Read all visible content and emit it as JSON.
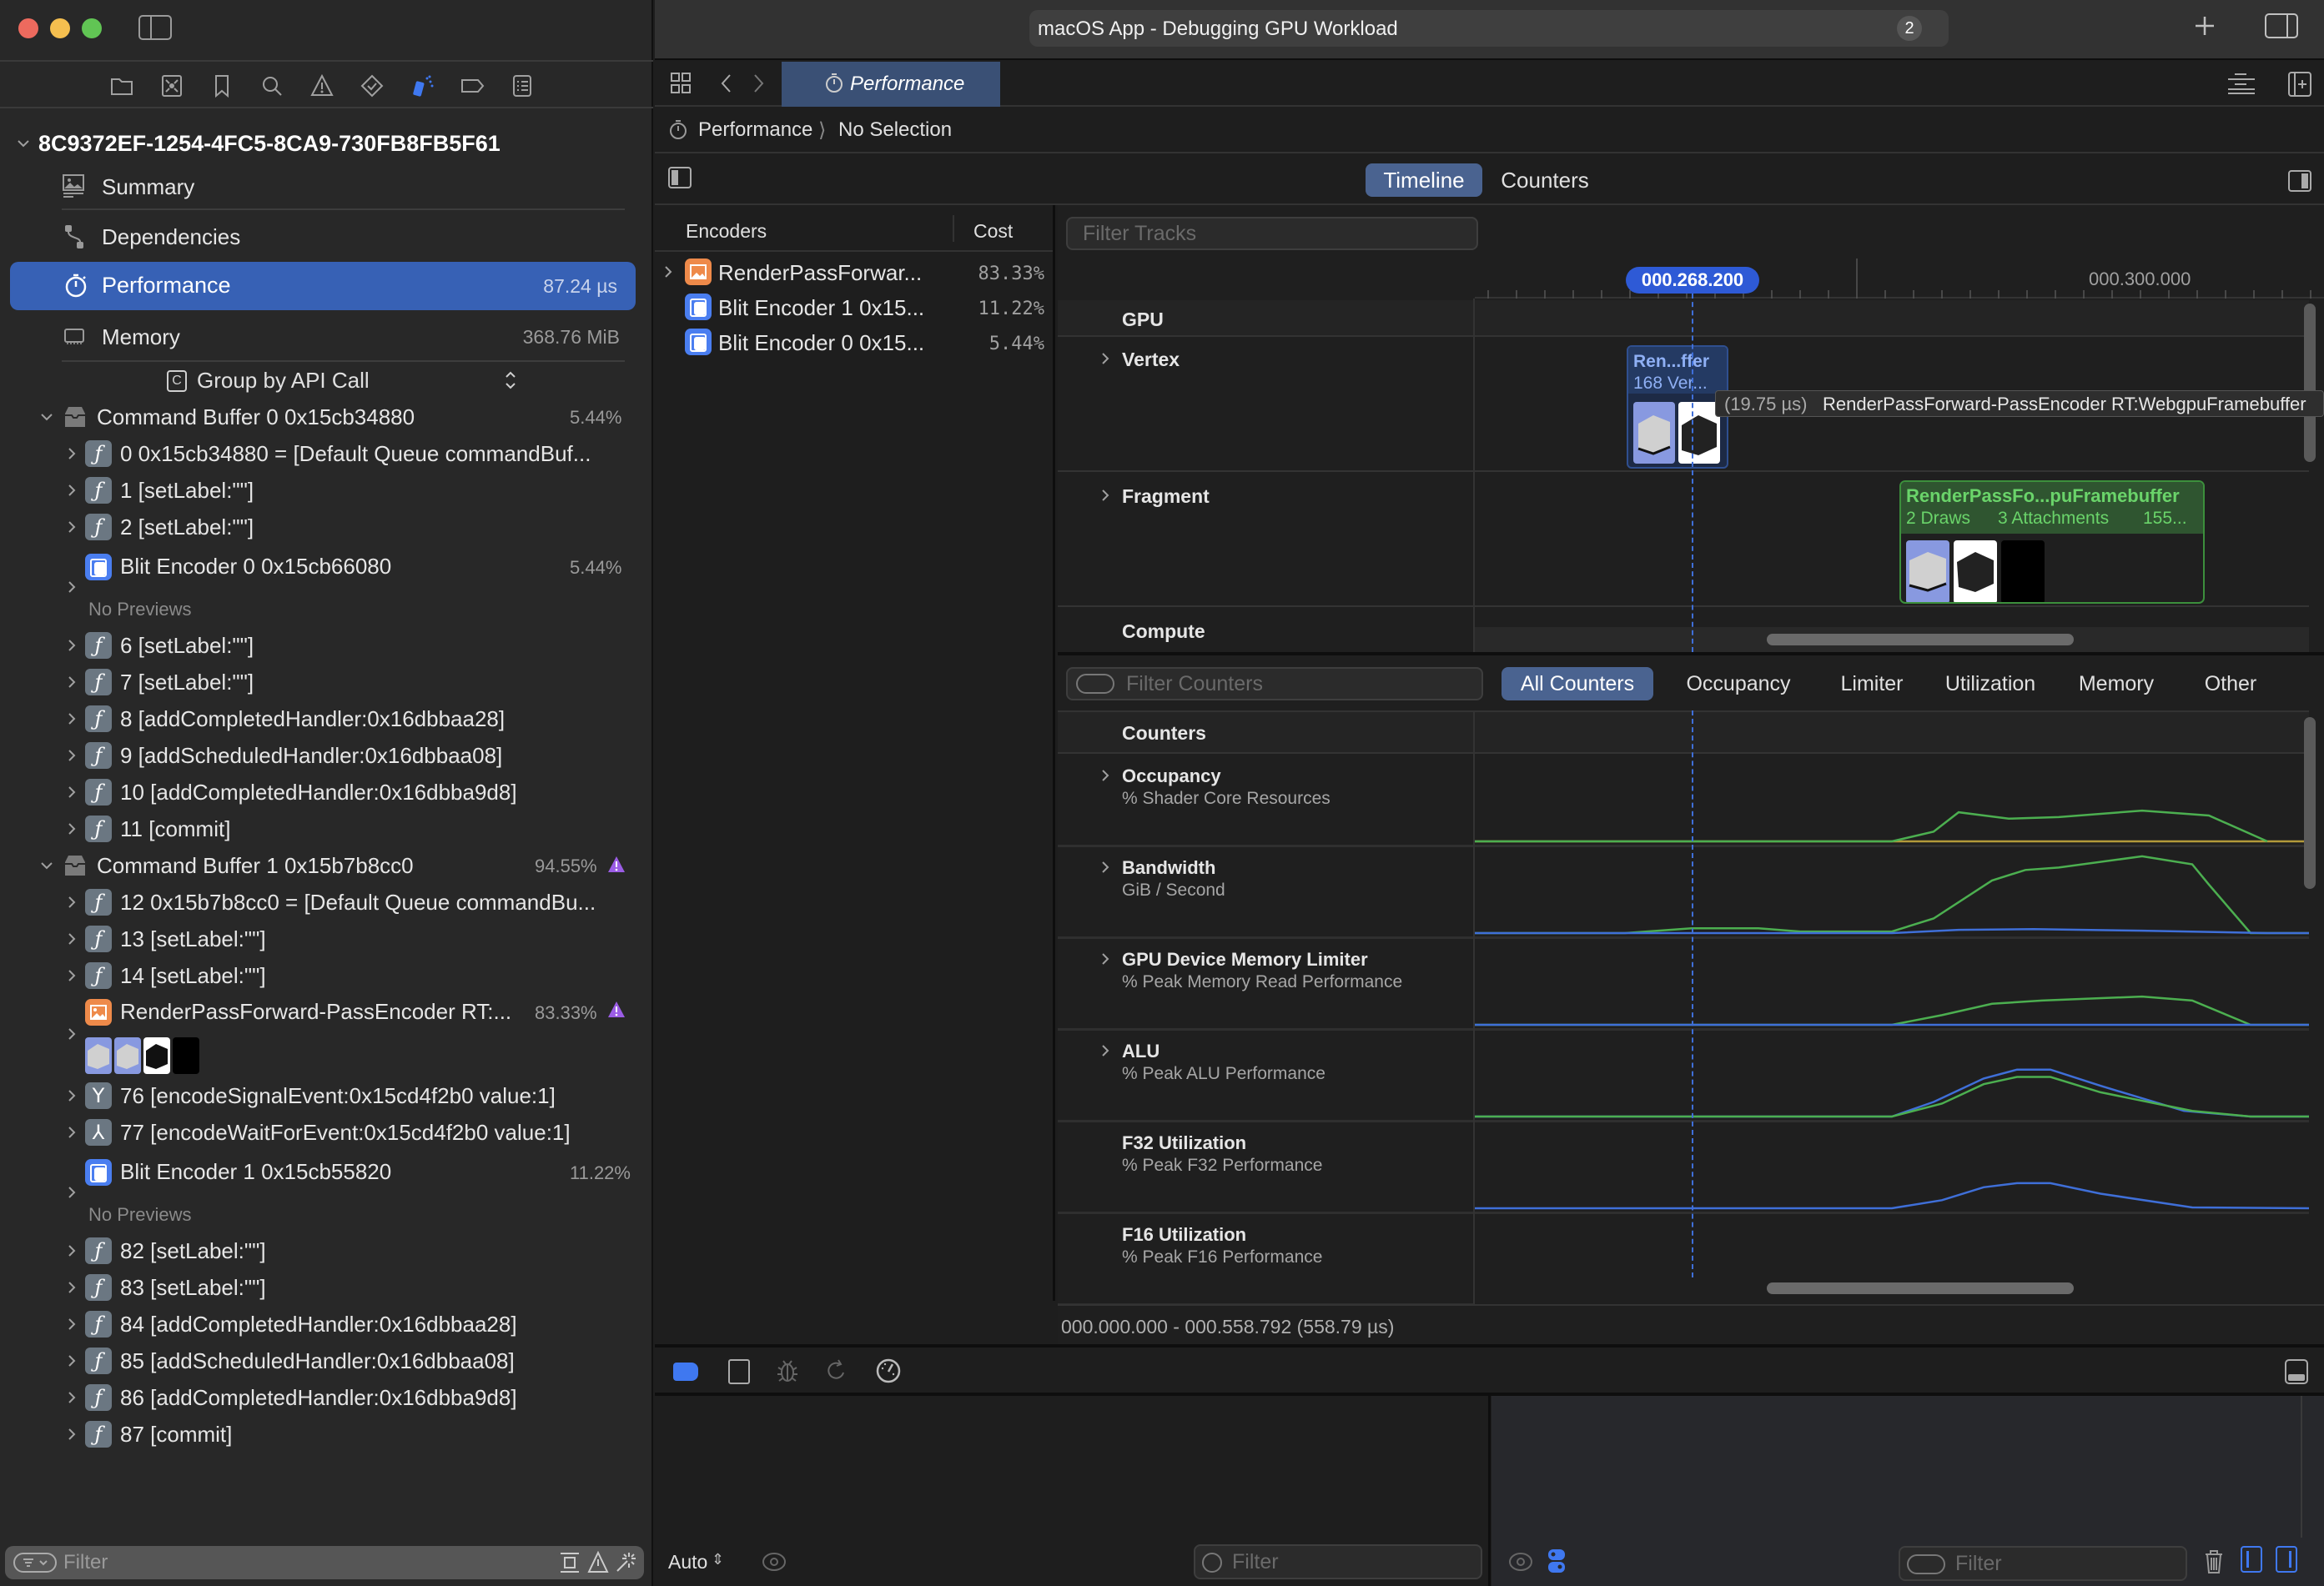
{
  "window": {
    "title": "macOS App - Debugging GPU Workload",
    "badge_count": "2"
  },
  "sidebar": {
    "capture_id": "8C9372EF-1254-4FC5-8CA9-730FB8FB5F61",
    "nav_items": [
      {
        "label": "Summary",
        "value": "",
        "icon": "summary-icon"
      },
      {
        "label": "Dependencies",
        "value": "",
        "icon": "dependencies-icon"
      },
      {
        "label": "Performance",
        "value": "87.24 µs",
        "icon": "stopwatch-icon",
        "selected": true
      },
      {
        "label": "Memory",
        "value": "368.76 MiB",
        "icon": "memory-chip-icon"
      }
    ],
    "group_by": "Group by API Call",
    "tree": [
      {
        "kind": "buffer",
        "label": "Command Buffer 0 0x15cb34880",
        "pct": "5.44%",
        "warn": false
      },
      {
        "kind": "fn",
        "label": "0 0x15cb34880 = [Default Queue commandBuf..."
      },
      {
        "kind": "fn",
        "label": "1 [setLabel:\"\"]"
      },
      {
        "kind": "fn",
        "label": "2 [setLabel:\"\"]"
      },
      {
        "kind": "blit",
        "label": "Blit Encoder 0 0x15cb66080",
        "pct": "5.44%",
        "preview": "No Previews"
      },
      {
        "kind": "fn",
        "label": "6 [setLabel:\"\"]"
      },
      {
        "kind": "fn",
        "label": "7 [setLabel:\"\"]"
      },
      {
        "kind": "fn",
        "label": "8 [addCompletedHandler:0x16dbbaa28]"
      },
      {
        "kind": "fn",
        "label": "9 [addScheduledHandler:0x16dbbaa08]"
      },
      {
        "kind": "fn",
        "label": "10 [addCompletedHandler:0x16dbba9d8]"
      },
      {
        "kind": "fn",
        "label": "11 [commit]"
      },
      {
        "kind": "buffer",
        "label": "Command Buffer 1 0x15b7b8cc0",
        "pct": "94.55%",
        "warn": true
      },
      {
        "kind": "fn",
        "label": "12 0x15b7b8cc0 = [Default Queue commandBu..."
      },
      {
        "kind": "fn",
        "label": "13 [setLabel:\"\"]"
      },
      {
        "kind": "fn",
        "label": "14 [setLabel:\"\"]"
      },
      {
        "kind": "render",
        "label": "RenderPassForward-PassEncoder RT:...",
        "pct": "83.33%",
        "warn": true
      },
      {
        "kind": "signal",
        "label": "76 [encodeSignalEvent:0x15cd4f2b0 value:1]"
      },
      {
        "kind": "wait",
        "label": "77 [encodeWaitForEvent:0x15cd4f2b0 value:1]"
      },
      {
        "kind": "blit",
        "label": "Blit Encoder 1 0x15cb55820",
        "pct": "11.22%",
        "preview": "No Previews"
      },
      {
        "kind": "fn",
        "label": "82 [setLabel:\"\"]"
      },
      {
        "kind": "fn",
        "label": "83 [setLabel:\"\"]"
      },
      {
        "kind": "fn",
        "label": "84 [addCompletedHandler:0x16dbbaa28]"
      },
      {
        "kind": "fn",
        "label": "85 [addScheduledHandler:0x16dbbaa08]"
      },
      {
        "kind": "fn",
        "label": "86 [addCompletedHandler:0x16dbba9d8]"
      },
      {
        "kind": "fn",
        "label": "87 [commit]"
      }
    ],
    "filter_placeholder": "Filter"
  },
  "editor": {
    "tab_label": "Performance",
    "breadcrumb": [
      "Performance",
      "No Selection"
    ],
    "modes": [
      {
        "label": "Timeline",
        "active": true
      },
      {
        "label": "Counters",
        "active": false
      }
    ]
  },
  "encoders": {
    "col_name": "Encoders",
    "col_cost": "Cost",
    "rows": [
      {
        "name": "RenderPassForwar...",
        "cost": "83.33%",
        "icon": "render"
      },
      {
        "name": "Blit Encoder 1 0x15...",
        "cost": "11.22%",
        "icon": "blit"
      },
      {
        "name": "Blit Encoder 0 0x15...",
        "cost": "5.44%",
        "icon": "blit"
      }
    ]
  },
  "timeline": {
    "filter_placeholder": "Filter Tracks",
    "playhead_time": "000.268.200",
    "ruler_label": "000.300.000",
    "tracks": [
      "GPU",
      "Vertex",
      "Fragment",
      "Compute"
    ],
    "vertex_block": {
      "title": "Ren...ffer",
      "subtitle": "168 Ver..."
    },
    "tooltip": {
      "duration": "(19.75 µs)",
      "name": "RenderPassForward-PassEncoder RT:WebgpuFramebuffer"
    },
    "fragment_block": {
      "title": "RenderPassFo...puFramebuffer",
      "draws": "2 Draws",
      "attachments": "3 Attachments",
      "extra": "155..."
    }
  },
  "counters": {
    "filter_placeholder": "Filter Counters",
    "tabs": [
      {
        "label": "All Counters",
        "active": true
      },
      {
        "label": "Occupancy"
      },
      {
        "label": "Limiter"
      },
      {
        "label": "Utilization"
      },
      {
        "label": "Memory"
      },
      {
        "label": "Other"
      }
    ],
    "header": "Counters",
    "rows": [
      {
        "title": "Occupancy",
        "subtitle": "% Shader Core Resources",
        "expandable": true
      },
      {
        "title": "Bandwidth",
        "subtitle": "GiB / Second",
        "expandable": true
      },
      {
        "title": "GPU Device Memory Limiter",
        "subtitle": "% Peak Memory Read Performance",
        "expandable": true
      },
      {
        "title": "ALU",
        "subtitle": "% Peak ALU Performance",
        "expandable": true
      },
      {
        "title": "F32 Utilization",
        "subtitle": "% Peak F32 Performance",
        "expandable": false
      },
      {
        "title": "F16 Utilization",
        "subtitle": "% Peak F16 Performance",
        "expandable": false
      }
    ],
    "range": "000.000.000 - 000.558.792 (558.79 µs)",
    "colors": {
      "green": "#4caf50",
      "blue": "#3f6fd8",
      "yellow": "#b39a3a",
      "playhead": "#3f6fd8"
    }
  },
  "debug": {
    "auto_label": "Auto",
    "vars_filter_placeholder": "Filter",
    "console_filter_placeholder": "Filter"
  }
}
